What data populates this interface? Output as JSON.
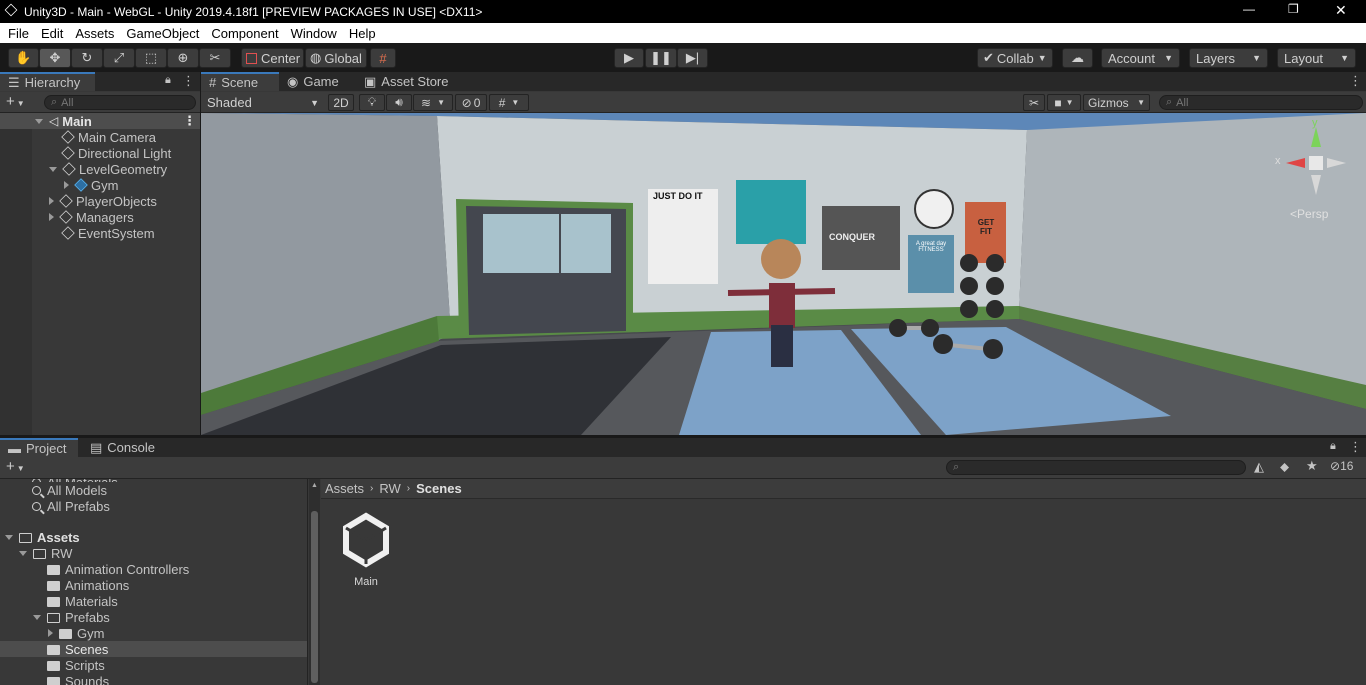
{
  "window": {
    "title": "Unity3D - Main - WebGL - Unity 2019.4.18f1 [PREVIEW PACKAGES IN USE] <DX11>",
    "minimize": "—",
    "maximize": "❐",
    "close": "✕"
  },
  "menu": [
    "File",
    "Edit",
    "Assets",
    "GameObject",
    "Component",
    "Window",
    "Help"
  ],
  "toolbar": {
    "pivot": "Center",
    "space": "Global",
    "collab": "Collab",
    "account": "Account",
    "layers": "Layers",
    "layout": "Layout"
  },
  "hierarchy": {
    "tab": "Hierarchy",
    "search_placeholder": "All",
    "scene": "Main",
    "items": [
      {
        "label": "Main Camera",
        "expandable": false
      },
      {
        "label": "Directional Light",
        "expandable": false
      },
      {
        "label": "LevelGeometry",
        "expandable": true,
        "expanded": true
      },
      {
        "label": "Gym",
        "expandable": true,
        "expanded": false,
        "child": true
      },
      {
        "label": "PlayerObjects",
        "expandable": true,
        "expanded": false
      },
      {
        "label": "Managers",
        "expandable": true,
        "expanded": false
      },
      {
        "label": "EventSystem",
        "expandable": false
      }
    ]
  },
  "scene_view": {
    "tabs": [
      "Scene",
      "Game",
      "Asset Store"
    ],
    "active_tab": "Scene",
    "shading_mode": "Shaded",
    "mode_2d": "2D",
    "hidden_count": "0",
    "gizmos": "Gizmos",
    "search_placeholder": "All",
    "persp": "Persp",
    "axis_x": "x",
    "axis_y": "y"
  },
  "scene_props": {
    "posters": [
      "JUST DO IT",
      "CONQUER",
      "GET FIT",
      "A great day FITNESS"
    ]
  },
  "project": {
    "tabs": [
      "Project",
      "Console"
    ],
    "active_tab": "Project",
    "hidden_count": "16",
    "favorites": [
      "All Materials",
      "All Models",
      "All Prefabs"
    ],
    "assets_root": "Assets",
    "tree": [
      {
        "label": "RW",
        "depth": 1,
        "expanded": true
      },
      {
        "label": "Animation Controllers",
        "depth": 2
      },
      {
        "label": "Animations",
        "depth": 2
      },
      {
        "label": "Materials",
        "depth": 2
      },
      {
        "label": "Prefabs",
        "depth": 2,
        "expanded": true
      },
      {
        "label": "Gym",
        "depth": 3,
        "expandable": true
      },
      {
        "label": "Scenes",
        "depth": 2,
        "selected": true
      },
      {
        "label": "Scripts",
        "depth": 2
      },
      {
        "label": "Sounds",
        "depth": 2
      }
    ],
    "breadcrumb": [
      "Assets",
      "RW",
      "Scenes"
    ],
    "files": [
      {
        "label": "Main",
        "type": "unity-scene"
      }
    ]
  },
  "colors": {
    "accent": "#3a79bb",
    "selected": "#2c5d87",
    "panel": "#383838",
    "toolbar": "#191919"
  }
}
